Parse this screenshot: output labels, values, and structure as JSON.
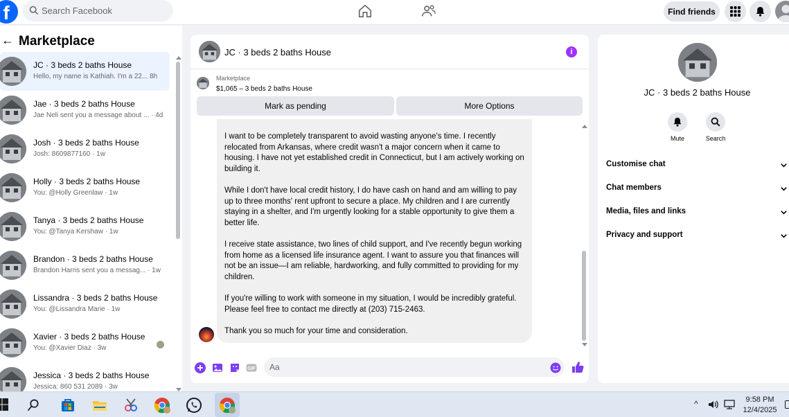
{
  "topbar": {
    "logo_letter": "f",
    "search_placeholder": "Search Facebook",
    "find_friends_label": "Find friends"
  },
  "left": {
    "title": "Marketplace",
    "back_glyph": "←",
    "conversations": [
      {
        "name": "JC · 3 beds 2 baths House",
        "preview": "Hello, my name is Kathiah. I'm a 22...  8h",
        "active": true
      },
      {
        "name": "Jae · 3 beds 2 baths House",
        "preview": "Jae Neli sent you a message about ... · 4d"
      },
      {
        "name": "Josh · 3 beds 2 baths House",
        "preview": "Josh: 8609877160 · 1w"
      },
      {
        "name": "Holly · 3 beds 2 baths House",
        "preview": "You: @Holly Greenlaw · 1w"
      },
      {
        "name": "Tanya · 3 beds 2 baths House",
        "preview": "You: @Tanya Kershaw · 1w"
      },
      {
        "name": "Brandon · 3 beds 2 baths House",
        "preview": "Brandon Harris sent you a messag...  · 1w"
      },
      {
        "name": "Lissandra · 3 beds 2 baths House",
        "preview": "You: @Lissandra Marie · 1w"
      },
      {
        "name": "Xavier · 3 beds 2 baths House",
        "preview": "You: @Xavier Diaz · 3w"
      },
      {
        "name": "Jessica · 3 beds 2 baths House",
        "preview": "Jessica: 860 531 2089 · 3w"
      }
    ]
  },
  "chat": {
    "title": "JC · 3 beds 2 baths House",
    "listing_label": "Marketplace",
    "listing_price": "$1,065 – 3 beds 2 baths House",
    "mark_pending_label": "Mark as pending",
    "more_options_label": "More Options",
    "paragraphs": [
      "I want to be completely transparent to avoid wasting anyone's time. I recently relocated from Arkansas, where credit wasn't a major concern when it came to housing. I have not yet established credit in Connecticut, but I am actively working on building it.",
      "While I don't have local credit history, I do have cash on hand and am willing to pay up to three months' rent upfront to secure a place. My children and I are currently staying in a shelter, and I'm urgently looking for a stable opportunity to give them a better life.",
      "I receive state assistance, two lines of child support, and I've recently begun working from home as a licensed life insurance agent. I want to assure you that finances will not be an issue—I am reliable, hardworking, and fully committed to providing for my children.",
      "If you're willing to work with someone in my situation, I would be incredibly grateful. Please feel free to contact me directly at (203) 715-2463.",
      "Thank you so much for your time and consideration."
    ],
    "composer_placeholder": "Aa"
  },
  "right_panel": {
    "title": "JC · 3 beds 2 baths House",
    "mute_label": "Mute",
    "search_label": "Search",
    "rows": [
      "Customise chat",
      "Chat members",
      "Media, files and links",
      "Privacy and support"
    ]
  },
  "taskbar": {
    "time": "9:58 PM",
    "date": "12/4/2025"
  },
  "colors": {
    "brand_blue": "#0866ff",
    "messenger_purple": "#a033ff",
    "active_conversation_bg": "#ebf3ff"
  }
}
